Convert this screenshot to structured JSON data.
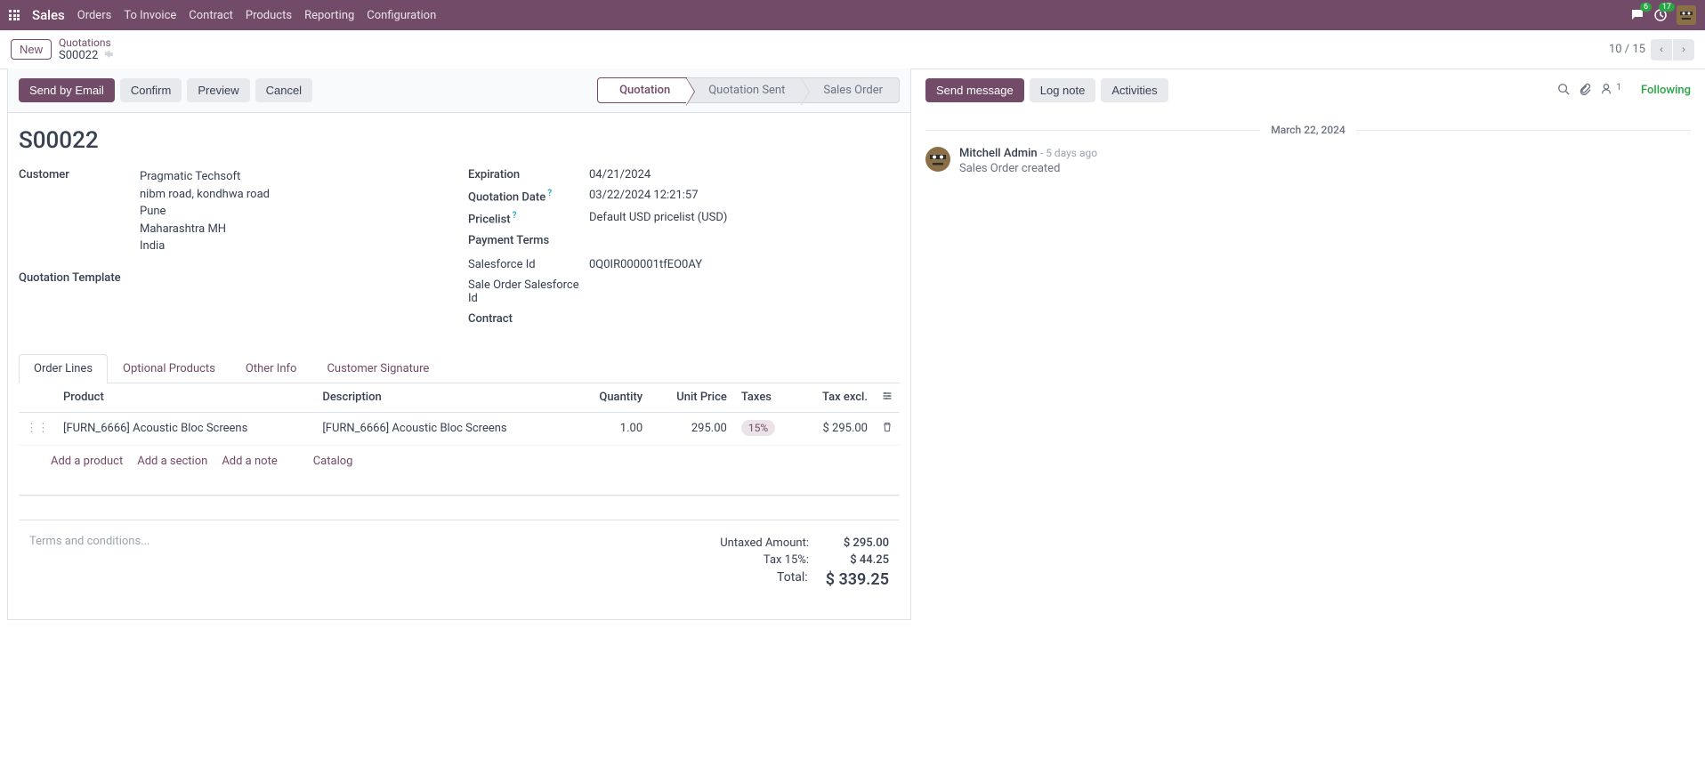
{
  "topbar": {
    "app": "Sales",
    "nav": [
      "Orders",
      "To Invoice",
      "Contract",
      "Products",
      "Reporting",
      "Configuration"
    ],
    "chat_badge": "6",
    "activity_badge": "17"
  },
  "subheader": {
    "new_btn": "New",
    "breadcrumb_parent": "Quotations",
    "breadcrumb_current": "S00022",
    "pager": "10 / 15"
  },
  "actions": {
    "send_email": "Send by Email",
    "confirm": "Confirm",
    "preview": "Preview",
    "cancel": "Cancel",
    "statuses": [
      "Quotation",
      "Quotation Sent",
      "Sales Order"
    ],
    "active_status_index": 0
  },
  "chatter": {
    "send_message": "Send message",
    "log_note": "Log note",
    "activities": "Activities",
    "follower_count": "1",
    "following": "Following",
    "date": "March 22, 2024",
    "msg_author": "Mitchell Admin",
    "msg_time": "- 5 days ago",
    "msg_text": "Sales Order created"
  },
  "record": {
    "title": "S00022",
    "labels": {
      "customer": "Customer",
      "quotation_template": "Quotation Template",
      "expiration": "Expiration",
      "quotation_date": "Quotation Date",
      "pricelist": "Pricelist",
      "payment_terms": "Payment Terms",
      "salesforce_id": "Salesforce Id",
      "sale_order_sf_id": "Sale Order Salesforce Id",
      "contract": "Contract"
    },
    "customer": {
      "name": "Pragmatic Techsoft",
      "street": "nibm road, kondhwa road",
      "city": "Pune",
      "state": "Maharashtra MH",
      "country": "India"
    },
    "expiration": "04/21/2024",
    "quotation_date": "03/22/2024 12:21:57",
    "pricelist": "Default USD pricelist (USD)",
    "salesforce_id": "0Q0IR000001tfEO0AY"
  },
  "tabs": [
    "Order Lines",
    "Optional Products",
    "Other Info",
    "Customer Signature"
  ],
  "table": {
    "headers": {
      "product": "Product",
      "description": "Description",
      "quantity": "Quantity",
      "unit_price": "Unit Price",
      "taxes": "Taxes",
      "tax_excl": "Tax excl."
    },
    "row": {
      "product": "[FURN_6666] Acoustic Bloc Screens",
      "description": "[FURN_6666] Acoustic Bloc Screens",
      "quantity": "1.00",
      "unit_price": "295.00",
      "tax": "15%",
      "tax_excl": "$ 295.00"
    },
    "add_links": {
      "product": "Add a product",
      "section": "Add a section",
      "note": "Add a note",
      "catalog": "Catalog"
    }
  },
  "totals": {
    "terms_placeholder": "Terms and conditions...",
    "untaxed_label": "Untaxed Amount:",
    "untaxed_val": "$ 295.00",
    "tax_label": "Tax 15%:",
    "tax_val": "$ 44.25",
    "total_label": "Total:",
    "total_val": "$ 339.25"
  }
}
